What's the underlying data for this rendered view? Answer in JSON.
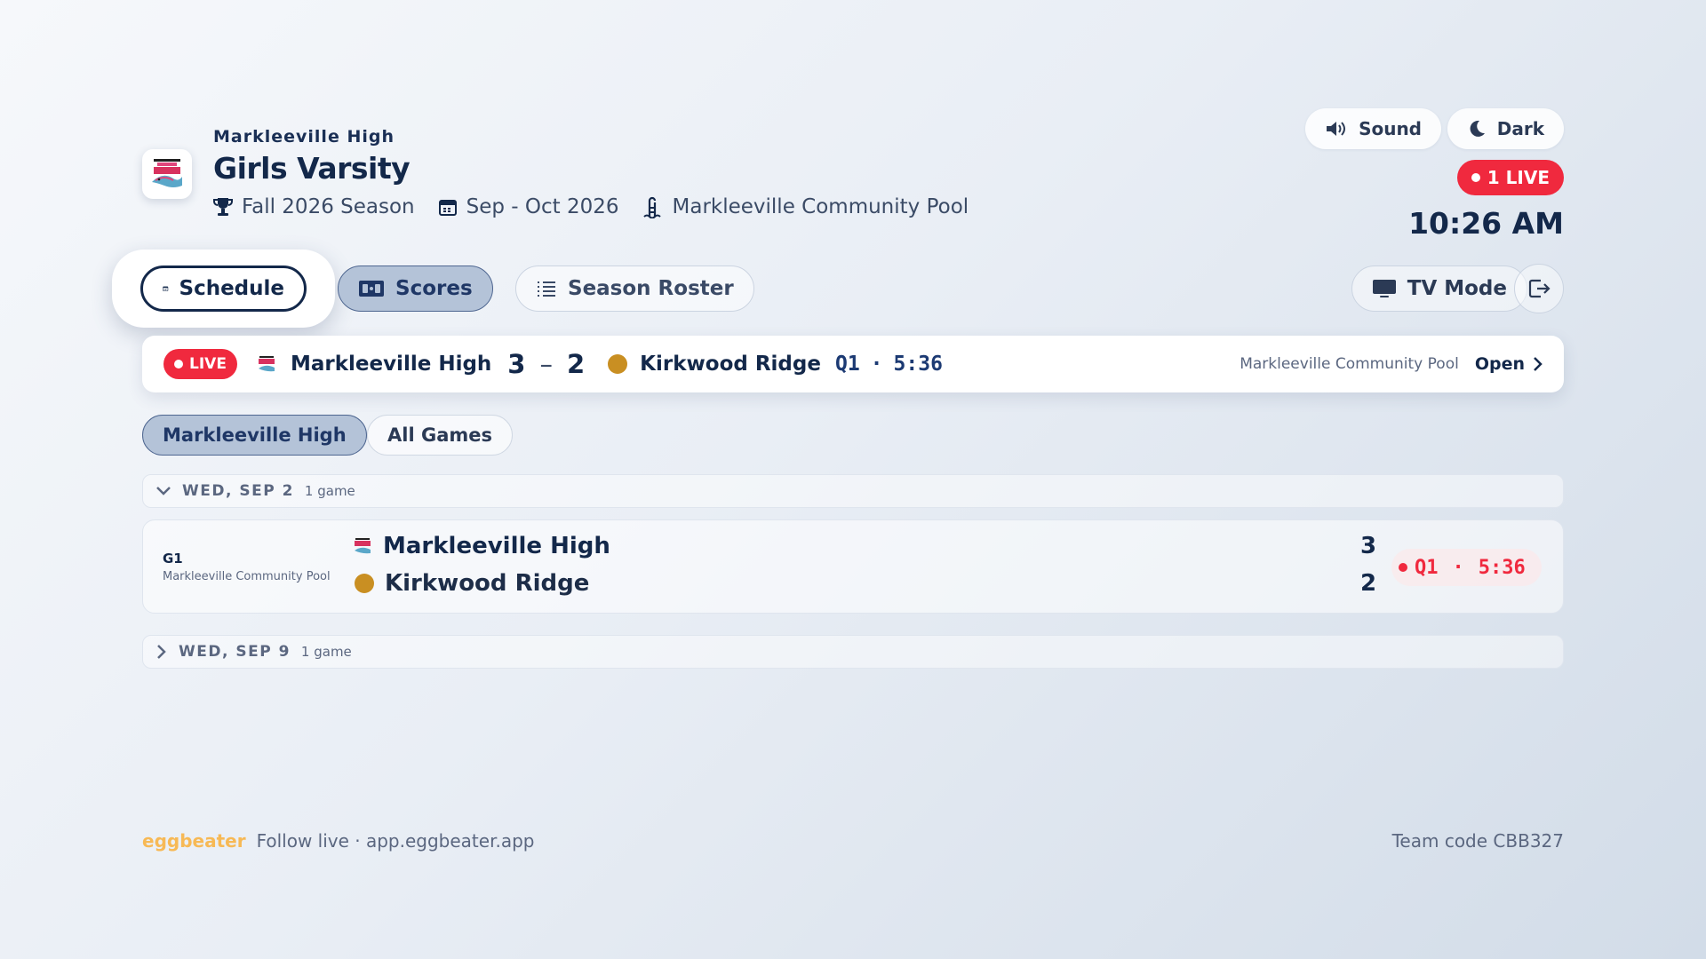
{
  "header": {
    "school": "Markleeville High",
    "team": "Girls Varsity",
    "season": "Fall 2026 Season",
    "dates": "Sep - Oct 2026",
    "venue": "Markleeville Community Pool",
    "logo_icon": "trout-logo"
  },
  "controls": {
    "sound_label": "Sound",
    "dark_label": "Dark",
    "live_count_label": "1 LIVE",
    "clock": "10:26 AM"
  },
  "tabs": [
    {
      "label": "Schedule",
      "icon": "calendar-icon",
      "state": "focused"
    },
    {
      "label": "Scores",
      "icon": "scoreboard-icon",
      "state": "selected"
    },
    {
      "label": "Season Roster",
      "icon": "list-icon",
      "state": "default"
    }
  ],
  "tv_mode_label": "TV Mode",
  "live_banner": {
    "badge": "LIVE",
    "home_team": "Markleeville High",
    "home_score": "3",
    "separator": "–",
    "away_score": "2",
    "away_team": "Kirkwood Ridge",
    "period": "Q1",
    "dot": "·",
    "clock": "5:36",
    "venue": "Markleeville Community Pool",
    "open_label": "Open"
  },
  "filters": [
    {
      "label": "Markleeville High",
      "active": true
    },
    {
      "label": "All Games",
      "active": false
    }
  ],
  "schedule": [
    {
      "date": "WED, SEP 2",
      "count": "1 game",
      "expanded": true,
      "games": [
        {
          "code": "G1",
          "venue": "Markleeville Community Pool",
          "home_team": "Markleeville High",
          "home_score": "3",
          "away_team": "Kirkwood Ridge",
          "away_score": "2",
          "period": "Q1",
          "dot": "·",
          "clock": "5:36"
        }
      ]
    },
    {
      "date": "WED, SEP 9",
      "count": "1 game",
      "expanded": false
    }
  ],
  "footer": {
    "brand": "eggbeater",
    "follow": "Follow live · app.eggbeater.app",
    "team_code": "Team code CBB327"
  },
  "colors": {
    "navy": "#13284a",
    "live_red": "#f0293e",
    "away_gold": "#c98f22",
    "brand_orange": "#f7b955"
  }
}
